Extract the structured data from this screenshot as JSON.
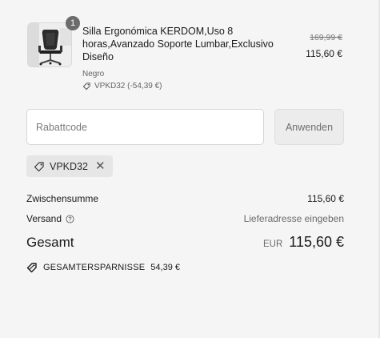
{
  "product": {
    "quantity": "1",
    "title": "Silla Ergonómica KERDOM,Uso 8 horas,Avanzado Soporte Lumbar,Exclusivo Diseño",
    "variant": "Negro",
    "discount_line": "VPKD32 (-54,39 €)",
    "price_original": "169,99 €",
    "price_current": "115,60 €",
    "image": "chair-thumbnail"
  },
  "discount": {
    "placeholder": "Rabattcode",
    "value": "",
    "apply_label": "Anwenden",
    "applied_code": "VPKD32"
  },
  "summary": {
    "subtotal_label": "Zwischensumme",
    "subtotal_value": "115,60 €",
    "shipping_label": "Versand",
    "shipping_value": "Lieferadresse eingeben",
    "total_label": "Gesamt",
    "currency": "EUR",
    "total_value": "115,60 €",
    "savings_label": "GESAMTERSPARNISSE",
    "savings_value": "54,39 €"
  },
  "colors": {
    "background": "#f5f5f5",
    "text": "#1a1a1a",
    "muted": "#6b6b6b",
    "badge": "#6b6b6b",
    "chip": "#e6e6e6"
  },
  "icons": [
    "tag-icon",
    "help-circle-icon",
    "close-icon",
    "savings-tag-icon"
  ]
}
